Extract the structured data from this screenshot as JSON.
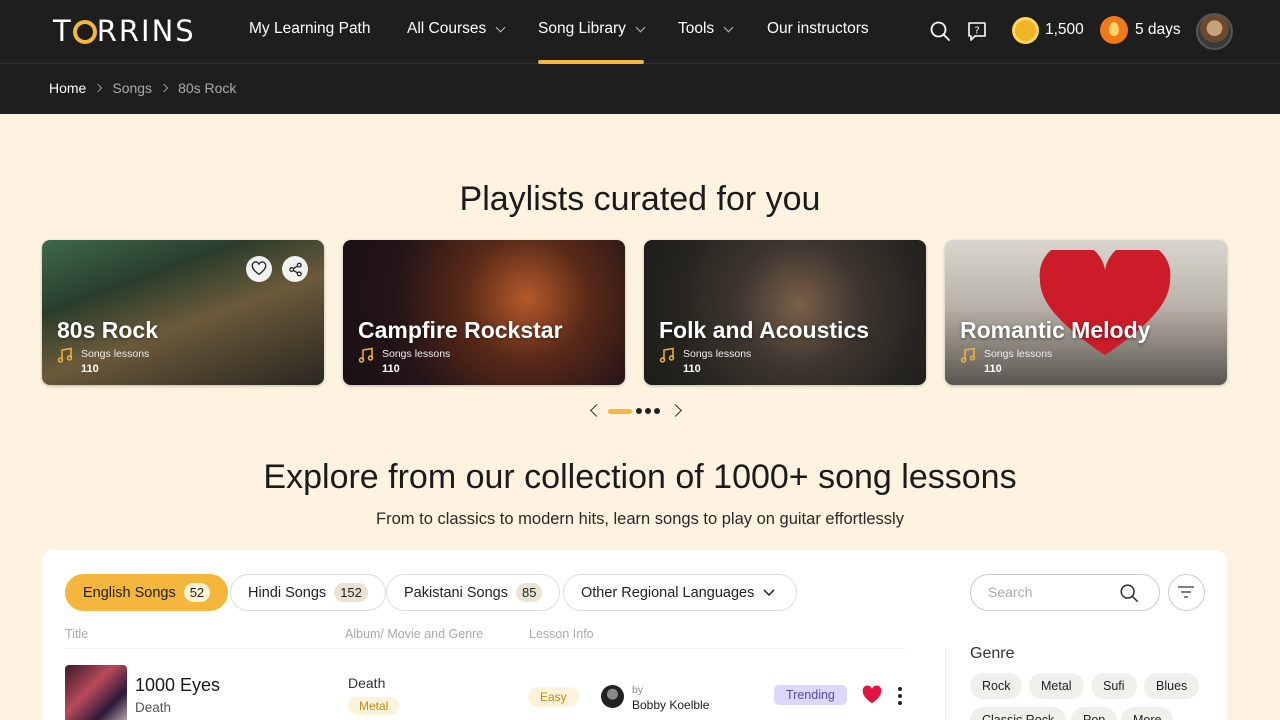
{
  "brand": {
    "logo": "TORRINS"
  },
  "nav": {
    "items": [
      {
        "label": "My Learning Path"
      },
      {
        "label": "All Courses"
      },
      {
        "label": "Song Library"
      },
      {
        "label": "Tools"
      },
      {
        "label": "Our instructors"
      }
    ],
    "active": "Song Library"
  },
  "header": {
    "coins": "1,500",
    "streak": "5 days"
  },
  "breadcrumb": {
    "home": "Home",
    "songs": "Songs",
    "current": "80s Rock"
  },
  "playlists": {
    "title": "Playlists curated for you",
    "cards": [
      {
        "name": "80s Rock",
        "sub": "Songs lessons",
        "count": "110"
      },
      {
        "name": "Campfire Rockstar",
        "sub": "Songs lessons",
        "count": "110"
      },
      {
        "name": "Folk and Acoustics",
        "sub": "Songs lessons",
        "count": "110"
      },
      {
        "name": "Romantic Melody",
        "sub": "Songs lessons",
        "count": "110"
      }
    ]
  },
  "explore": {
    "title": "Explore from our collection of 1000+ song lessons",
    "subtitle": "From to classics to modern hits, learn songs to play on guitar effortlessly"
  },
  "filters": {
    "tabs": [
      {
        "label": "English Songs",
        "count": "52"
      },
      {
        "label": "Hindi Songs",
        "count": "152"
      },
      {
        "label": "Pakistani Songs",
        "count": "85"
      },
      {
        "label": "Other Regional Languages"
      }
    ],
    "search_placeholder": "Search"
  },
  "table": {
    "columns": [
      "Title",
      "Album/ Movie and Genre",
      "Lesson Info"
    ],
    "rows": [
      {
        "title": "1000 Eyes",
        "artist": "Death",
        "album": "Death",
        "genre": "Metal",
        "level": "Easy",
        "by": "by",
        "instructor": "Bobby Koelble",
        "badge": "Trending"
      }
    ]
  },
  "genre_filter": {
    "label": "Genre",
    "chips": [
      "Rock",
      "Metal",
      "Sufi",
      "Blues",
      "Classic Rock",
      "Pop",
      "More"
    ]
  },
  "colors": {
    "accent": "#f4b63c",
    "header_bg": "#1e1e1e",
    "page_bg": "#fdf3e0",
    "trending_bg": "#dcd7fb",
    "heart": "#e0143c"
  }
}
